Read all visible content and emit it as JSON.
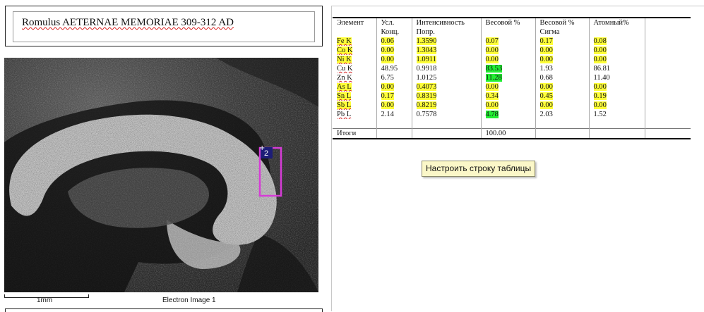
{
  "title": {
    "text": "Romulus AETERNAE MEMORIAE 309-312 AD"
  },
  "image": {
    "caption": "Electron Image 1",
    "scale_label": "1mm",
    "spectrum_label": "2",
    "marker_color": "#d63cd6"
  },
  "table": {
    "columns": [
      "Элемент",
      "Усл.",
      "Интенсивность",
      "Весовой %",
      "Весовой %",
      "Атомный%",
      ""
    ],
    "subheaders": [
      "",
      "Конц.",
      "Попр.",
      "",
      "Сигма",
      "",
      ""
    ],
    "rows": [
      {
        "element": "Fe K",
        "conc": "0.06",
        "intensity": "1.3590",
        "wt": "0.07",
        "sigma": "0.17",
        "atomic": "0.08"
      },
      {
        "element": "Co K",
        "conc": "0.00",
        "intensity": "1.3043",
        "wt": "0.00",
        "sigma": "0.00",
        "atomic": "0.00"
      },
      {
        "element": "Ni K",
        "conc": "0.00",
        "intensity": "1.0911",
        "wt": "0.00",
        "sigma": "0.00",
        "atomic": "0.00"
      },
      {
        "element": "Cu K",
        "conc": "48.95",
        "intensity": "0.9918",
        "wt": "83.53",
        "sigma": "1.93",
        "atomic": "86.81"
      },
      {
        "element": "Zn K",
        "conc": "6.75",
        "intensity": "1.0125",
        "wt": "11.28",
        "sigma": "0.68",
        "atomic": "11.40"
      },
      {
        "element": "As L",
        "conc": "0.00",
        "intensity": "0.4073",
        "wt": "0.00",
        "sigma": "0.00",
        "atomic": "0.00"
      },
      {
        "element": "Sn L",
        "conc": "0.17",
        "intensity": "0.8319",
        "wt": "0.34",
        "sigma": "0.45",
        "atomic": "0.19"
      },
      {
        "element": "Sb L",
        "conc": "0.00",
        "intensity": "0.8219",
        "wt": "0.00",
        "sigma": "0.00",
        "atomic": "0.00"
      },
      {
        "element": "Pb L",
        "conc": "2.14",
        "intensity": "0.7578",
        "wt": "4.78",
        "sigma": "2.03",
        "atomic": "1.52"
      }
    ],
    "totals": {
      "label": "Итоги",
      "wt": "100.00"
    },
    "highlight_yellow": "#ffff38",
    "highlight_green": "#22ee33"
  },
  "tooltip": {
    "text": "Настроить строку таблицы"
  }
}
